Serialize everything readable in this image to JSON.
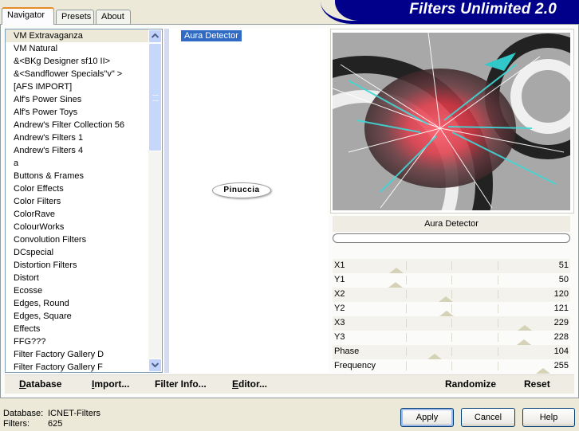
{
  "tabs": [
    "Navigator",
    "Presets",
    "About"
  ],
  "app_title": "Filters Unlimited 2.0",
  "categories": [
    "VM Extravaganza",
    "VM Natural",
    "&<BKg Designer sf10 II>",
    "&<Sandflower Specials\"v\" >",
    "[AFS IMPORT]",
    "Alf's Power Sines",
    "Alf's Power Toys",
    "Andrew's Filter Collection 56",
    "Andrew's Filters 1",
    "Andrew's Filters 4",
    "a",
    "Buttons & Frames",
    "Color Effects",
    "Color Filters",
    "ColorRave",
    "ColourWorks",
    "Convolution Filters",
    "DCspecial",
    "Distortion Filters",
    "Distort",
    "Ecosse",
    "Edges, Round",
    "Edges, Square",
    "Effects",
    "FFG???",
    "Filter Factory Gallery D",
    "Filter Factory Gallery F"
  ],
  "selected_category_index": 0,
  "filters": [
    "Aura Detector"
  ],
  "watermark": "Pinuccia",
  "current_filter": "Aura Detector",
  "progress": 0,
  "params": [
    {
      "label": "X1",
      "value": 51
    },
    {
      "label": "Y1",
      "value": 50
    },
    {
      "label": "X2",
      "value": 120
    },
    {
      "label": "Y2",
      "value": 121
    },
    {
      "label": "X3",
      "value": 229
    },
    {
      "label": "Y3",
      "value": 228
    },
    {
      "label": "Phase",
      "value": 104
    },
    {
      "label": "Frequency",
      "value": 255
    }
  ],
  "toolbar": {
    "database": "Database",
    "import": "Import...",
    "filter_info": "Filter Info...",
    "editor": "Editor...",
    "randomize": "Randomize",
    "reset": "Reset"
  },
  "status": {
    "database_label": "Database:",
    "database_value": "ICNET-Filters",
    "filters_label": "Filters:",
    "filters_value": "625"
  },
  "buttons": {
    "apply": "Apply",
    "cancel": "Cancel",
    "help": "Help"
  }
}
